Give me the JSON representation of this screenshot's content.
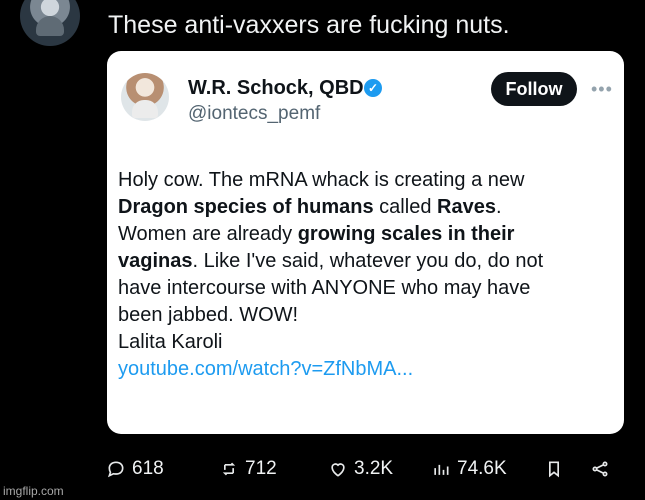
{
  "top_tweet": {
    "text": "These anti-vaxxers are fucking nuts."
  },
  "quote": {
    "author_name": "W.R. Schock, QBD",
    "handle": "@iontecs_pemf",
    "follow_label": "Follow",
    "body_lines": [
      [
        {
          "t": "Holy cow. The mRNA whack is creating a new ",
          "b": false
        }
      ],
      [
        {
          "t": "Dragon species of humans",
          "b": true
        },
        {
          "t": " called ",
          "b": false
        },
        {
          "t": "Raves",
          "b": true
        },
        {
          "t": ".",
          "b": false
        }
      ],
      [
        {
          "t": "Women are already ",
          "b": false
        },
        {
          "t": "growing scales in their",
          "b": true
        }
      ],
      [
        {
          "t": "vaginas",
          "b": true
        },
        {
          "t": ". Like I've said, whatever you do, do not",
          "b": false
        }
      ],
      [
        {
          "t": "have intercourse with ANYONE who may have",
          "b": false
        }
      ],
      [
        {
          "t": "been jabbed. WOW!",
          "b": false
        }
      ],
      [
        {
          "t": "Lalita Karoli",
          "b": false
        }
      ]
    ],
    "link": "youtube.com/watch?v=ZfNbMA..."
  },
  "actions": {
    "reply_count": "618",
    "retweet_count": "712",
    "like_count": "3.2K",
    "view_count": "74.6K"
  },
  "watermark": "imgflip.com"
}
